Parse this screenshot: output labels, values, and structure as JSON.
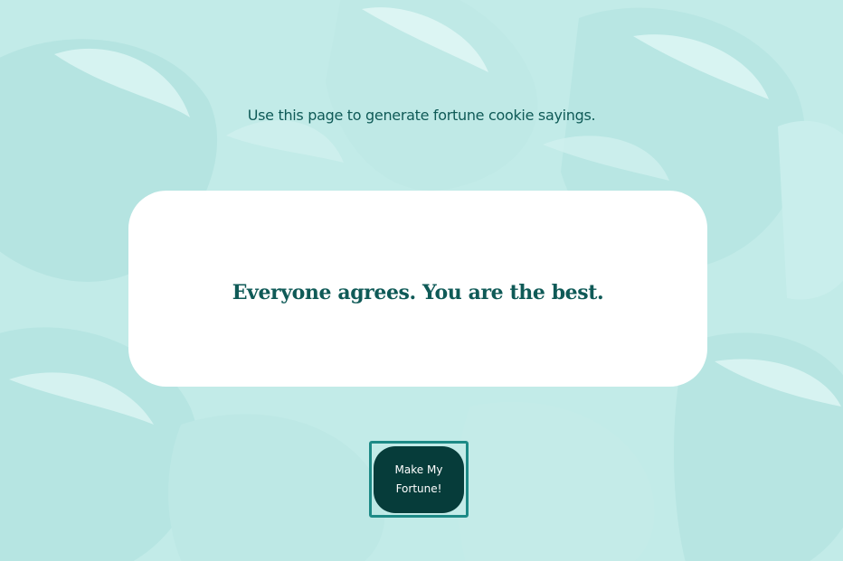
{
  "page": {
    "intro_text": "Use this page to generate fortune cookie sayings."
  },
  "fortune_card": {
    "text": "Everyone agrees. You are the best."
  },
  "make_fortune_button": {
    "label": "Make My\nFortune!"
  },
  "background": {
    "image": "fortune-cookies-pattern",
    "tint_color": "#c2ebe8"
  },
  "colors": {
    "text_accent": "#0f5a57",
    "button_fill": "#063c3a",
    "button_focus_ring": "#1d8a86",
    "card_fill": "#ffffff"
  }
}
